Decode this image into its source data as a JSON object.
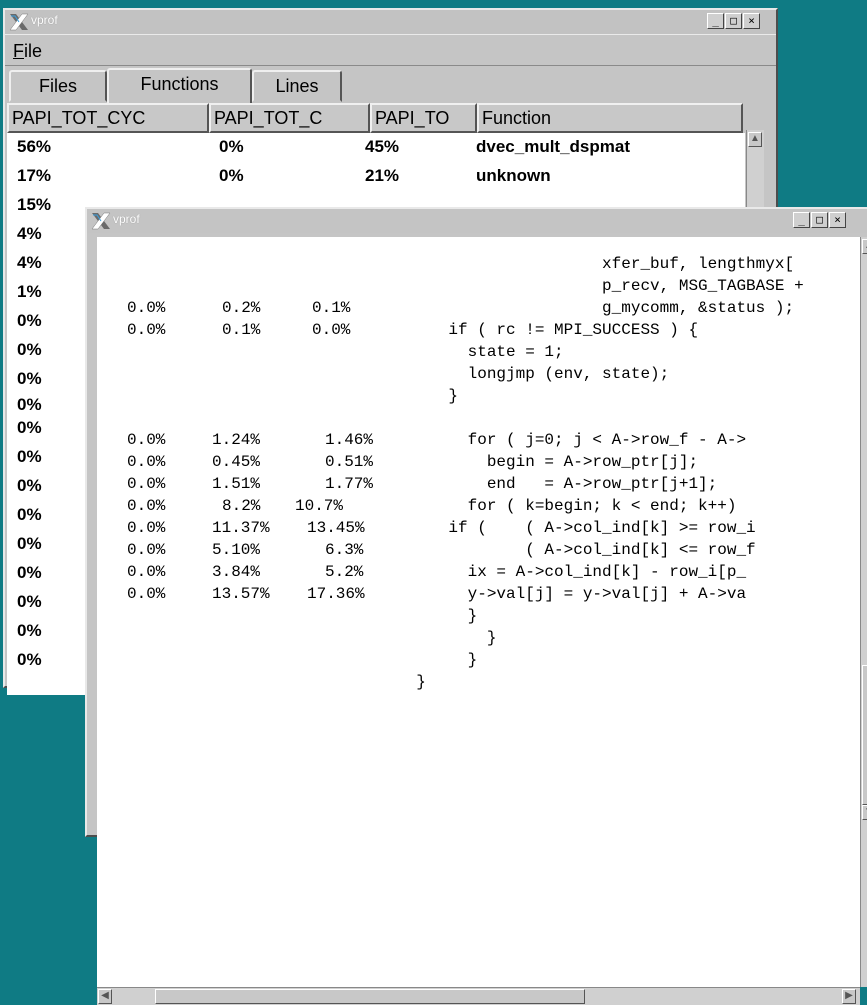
{
  "window1": {
    "title": "vprof",
    "menu": {
      "file": "File"
    },
    "tabs": [
      "Files",
      "Functions",
      "Lines"
    ],
    "columns": [
      "PAPI_TOT_CYC",
      "PAPI_TOT_C",
      "PAPI_TO",
      "Function"
    ],
    "rows": [
      {
        "cyc": "56%",
        "c": "0%",
        "to": "45%",
        "fn": "dvec_mult_dspmat"
      },
      {
        "cyc": "17%",
        "c": "0%",
        "to": "21%",
        "fn": "unknown"
      },
      {
        "cyc": "15%"
      },
      {
        "cyc": "4%"
      },
      {
        "cyc": "4%"
      },
      {
        "cyc": "1%"
      },
      {
        "cyc": "0%"
      },
      {
        "cyc": "0%"
      },
      {
        "cyc": "0%"
      },
      {
        "cyc": "0%"
      },
      {
        "cyc": "0%"
      },
      {
        "cyc": "0%"
      },
      {
        "cyc": "0%"
      },
      {
        "cyc": "0%"
      },
      {
        "cyc": "0%"
      },
      {
        "cyc": "0%"
      },
      {
        "cyc": "0%"
      },
      {
        "cyc": "0%"
      },
      {
        "cyc": "0%"
      }
    ]
  },
  "window2": {
    "title": "vprof",
    "lines": [
      {
        "a": "",
        "b": "",
        "c": "",
        "code": "                    xfer_buf, lengthmyx["
      },
      {
        "a": "",
        "b": "",
        "c": "",
        "code": "                    p_recv, MSG_TAGBASE +"
      },
      {
        "a": "0.0%",
        "b": "0.2%",
        "c": "0.1%",
        "code": "                    g_mycomm, &status );"
      },
      {
        "a": "0.0%",
        "b": "0.1%",
        "c": "0.0%",
        "code": "    if ( rc != MPI_SUCCESS ) {"
      },
      {
        "a": "",
        "b": "",
        "c": "",
        "code": "      state = 1;"
      },
      {
        "a": "",
        "b": "",
        "c": "",
        "code": "      longjmp (env, state);"
      },
      {
        "a": "",
        "b": "",
        "c": "",
        "code": "    }"
      },
      {
        "a": "",
        "b": "",
        "c": "",
        "code": ""
      },
      {
        "a": "0.0%",
        "b": "1.24%",
        "c": "1.46%",
        "code": "      for ( j=0; j < A->row_f - A->"
      },
      {
        "a": "0.0%",
        "b": "0.45%",
        "c": "0.51%",
        "code": "        begin = A->row_ptr[j];"
      },
      {
        "a": "0.0%",
        "b": "1.51%",
        "c": "1.77%",
        "code": "        end   = A->row_ptr[j+1];"
      },
      {
        "a": "0.0%",
        "b": "8.2%",
        "c": "10.7%",
        "code": "      for ( k=begin; k < end; k++)"
      },
      {
        "a": "0.0%",
        "b": "11.37%",
        "c": "13.45%",
        "code": "    if (    ( A->col_ind[k] >= row_i"
      },
      {
        "a": "0.0%",
        "b": "5.10%",
        "c": "6.3%",
        "code": "            ( A->col_ind[k] <= row_f"
      },
      {
        "a": "0.0%",
        "b": "3.84%",
        "c": "5.2%",
        "code": "      ix = A->col_ind[k] - row_i[p_"
      },
      {
        "a": "0.0%",
        "b": "13.57%",
        "c": "17.36%",
        "code": "      y->val[j] = y->val[j] + A->va"
      },
      {
        "a": "",
        "b": "",
        "c": "",
        "code": "      }"
      },
      {
        "a": "",
        "b": "",
        "c": "",
        "code": "        }"
      },
      {
        "a": "",
        "b": "",
        "c": "",
        "code": "      }"
      },
      {
        "a": "",
        "b": "",
        "c": "",
        "code": "  }"
      }
    ]
  },
  "buttons": {
    "minimize": "_",
    "maximize": "□",
    "close": "×"
  },
  "colors": {
    "desktop": "#0f7b84",
    "window": "#c5c5c5"
  }
}
